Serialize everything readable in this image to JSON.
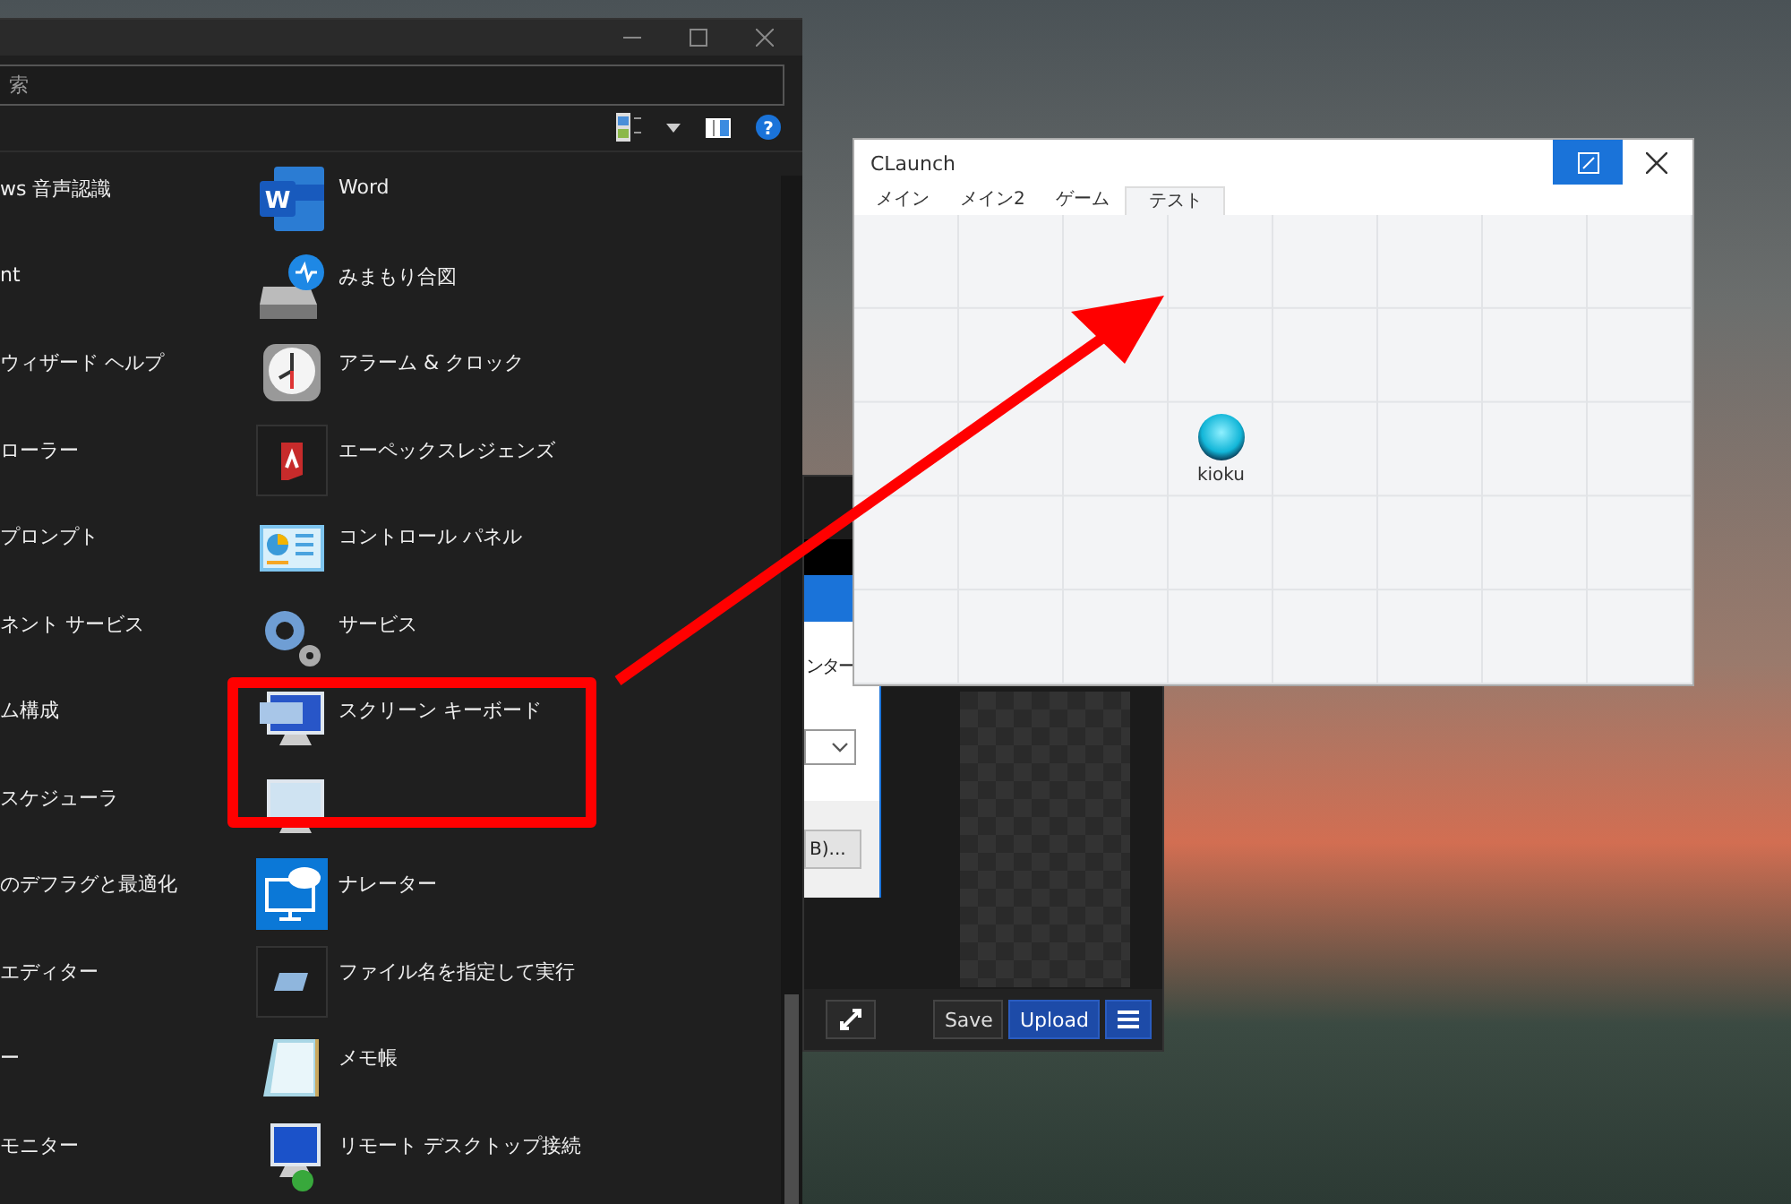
{
  "start_window": {
    "search": {
      "placeholder": "索"
    },
    "left_items": [
      "ws 音声認識",
      "nt",
      "ウィザード ヘルプ",
      "ローラー",
      "プロンプト",
      "ネント サービス",
      "ム構成",
      "スケジューラ",
      "のデフラグと最適化",
      "エディター",
      "ー",
      "モニター"
    ],
    "apps": [
      {
        "label": "Word",
        "kind": "word",
        "badge": "W"
      },
      {
        "label": "みまもり合図",
        "kind": "drive"
      },
      {
        "label": "アラーム & クロック",
        "kind": "clock"
      },
      {
        "label": "エーペックスレジェンズ",
        "kind": "game"
      },
      {
        "label": "コントロール パネル",
        "kind": "panel"
      },
      {
        "label": "サービス",
        "kind": "gears"
      },
      {
        "label": "スクリーン キーボード",
        "kind": "keyboard"
      },
      {
        "kind": "monitor"
      },
      {
        "label": "ナレーター",
        "kind": "narrator"
      },
      {
        "label": "ファイル名を指定して実行",
        "kind": "run"
      },
      {
        "label": "メモ帳",
        "kind": "notepad"
      },
      {
        "label": "リモート デスクトップ接続",
        "kind": "remote"
      }
    ],
    "help_glyph": "?"
  },
  "back_window": {
    "dialog_text": "ンター",
    "dialog_button": "B)...",
    "buttons": [
      "Save",
      "Upload"
    ]
  },
  "claunch": {
    "title": "CLaunch",
    "tabs": [
      {
        "label": "メイン",
        "selected": false
      },
      {
        "label": "メイン2",
        "selected": false
      },
      {
        "label": "ゲーム",
        "selected": false
      },
      {
        "label": "テスト",
        "selected": true
      }
    ],
    "items": [
      {
        "label": "kioku"
      }
    ]
  }
}
